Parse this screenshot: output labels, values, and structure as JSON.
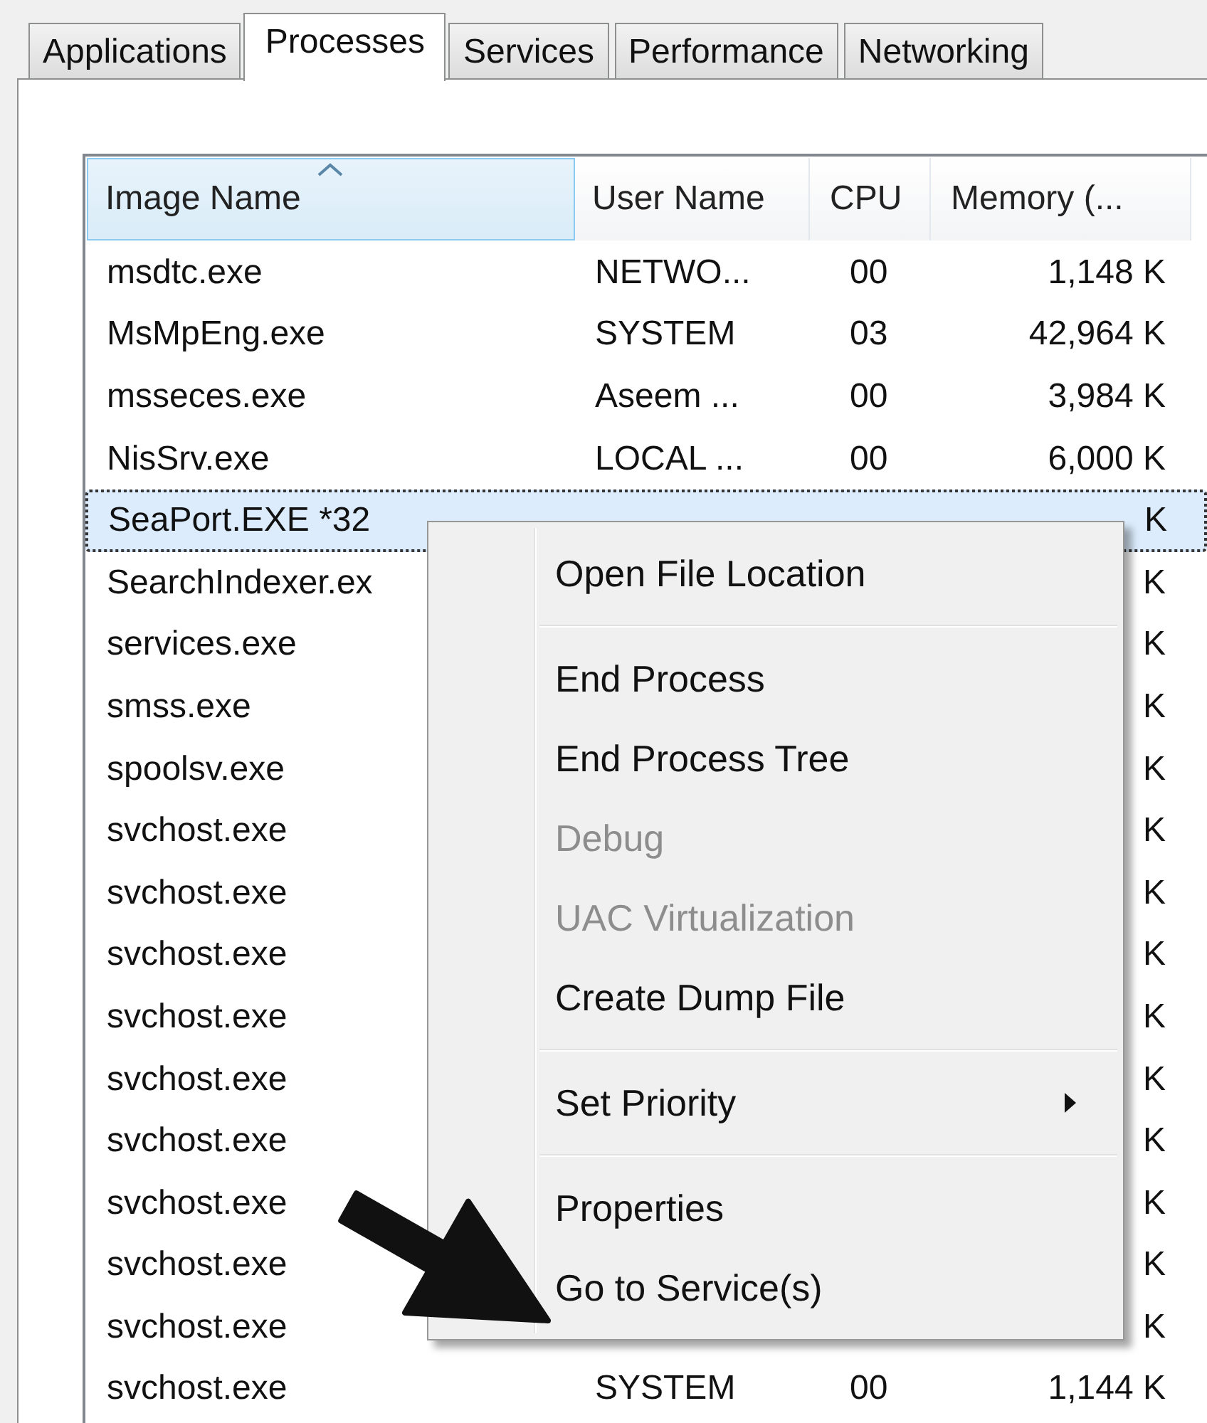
{
  "tabs": [
    {
      "label": "Applications",
      "selected": false
    },
    {
      "label": "Processes",
      "selected": true
    },
    {
      "label": "Services",
      "selected": false
    },
    {
      "label": "Performance",
      "selected": false
    },
    {
      "label": "Networking",
      "selected": false
    }
  ],
  "table": {
    "columns": [
      {
        "label": "Image Name",
        "sorted": true
      },
      {
        "label": "User Name",
        "sorted": false
      },
      {
        "label": "CPU",
        "sorted": false
      },
      {
        "label": "Memory (...",
        "sorted": false
      }
    ],
    "rows": [
      {
        "image": "msdtc.exe",
        "user": "NETWO...",
        "cpu": "00",
        "memory": "1,148 K",
        "selected": false
      },
      {
        "image": "MsMpEng.exe",
        "user": "SYSTEM",
        "cpu": "03",
        "memory": "42,964 K",
        "selected": false
      },
      {
        "image": "msseces.exe",
        "user": "Aseem ...",
        "cpu": "00",
        "memory": "3,984 K",
        "selected": false
      },
      {
        "image": "NisSrv.exe",
        "user": "LOCAL ...",
        "cpu": "00",
        "memory": "6,000 K",
        "selected": false
      },
      {
        "image": "SeaPort.EXE *32",
        "memory": "K",
        "selected": true
      },
      {
        "image": "SearchIndexer.ex",
        "memory": "K",
        "selected": false
      },
      {
        "image": "services.exe",
        "memory": "K",
        "selected": false
      },
      {
        "image": "smss.exe",
        "memory": "K",
        "selected": false
      },
      {
        "image": "spoolsv.exe",
        "memory": "K",
        "selected": false
      },
      {
        "image": "svchost.exe",
        "memory": "K",
        "selected": false
      },
      {
        "image": "svchost.exe",
        "memory": "K",
        "selected": false
      },
      {
        "image": "svchost.exe",
        "memory": "K",
        "selected": false
      },
      {
        "image": "svchost.exe",
        "memory": "K",
        "selected": false
      },
      {
        "image": "svchost.exe",
        "memory": "K",
        "selected": false
      },
      {
        "image": "svchost.exe",
        "memory": "K",
        "selected": false
      },
      {
        "image": "svchost.exe",
        "memory": "K",
        "selected": false
      },
      {
        "image": "svchost.exe",
        "memory": "K",
        "selected": false
      },
      {
        "image": "svchost.exe",
        "memory": "K",
        "selected": false
      },
      {
        "image": "svchost.exe",
        "user": "SYSTEM",
        "cpu": "00",
        "memory": "1,144 K",
        "selected": false
      }
    ]
  },
  "context_menu": {
    "items": [
      {
        "kind": "item",
        "label": "Open File Location",
        "disabled": false,
        "submenu": false
      },
      {
        "kind": "separator"
      },
      {
        "kind": "item",
        "label": "End Process",
        "disabled": false,
        "submenu": false
      },
      {
        "kind": "item",
        "label": "End Process Tree",
        "disabled": false,
        "submenu": false
      },
      {
        "kind": "item",
        "label": "Debug",
        "disabled": true,
        "submenu": false
      },
      {
        "kind": "item",
        "label": "UAC Virtualization",
        "disabled": true,
        "submenu": false
      },
      {
        "kind": "item",
        "label": "Create Dump File",
        "disabled": false,
        "submenu": false
      },
      {
        "kind": "separator"
      },
      {
        "kind": "item",
        "label": "Set Priority",
        "disabled": false,
        "submenu": true
      },
      {
        "kind": "separator"
      },
      {
        "kind": "item",
        "label": "Properties",
        "disabled": false,
        "submenu": false
      },
      {
        "kind": "item",
        "label": "Go to Service(s)",
        "disabled": false,
        "submenu": false
      }
    ]
  }
}
